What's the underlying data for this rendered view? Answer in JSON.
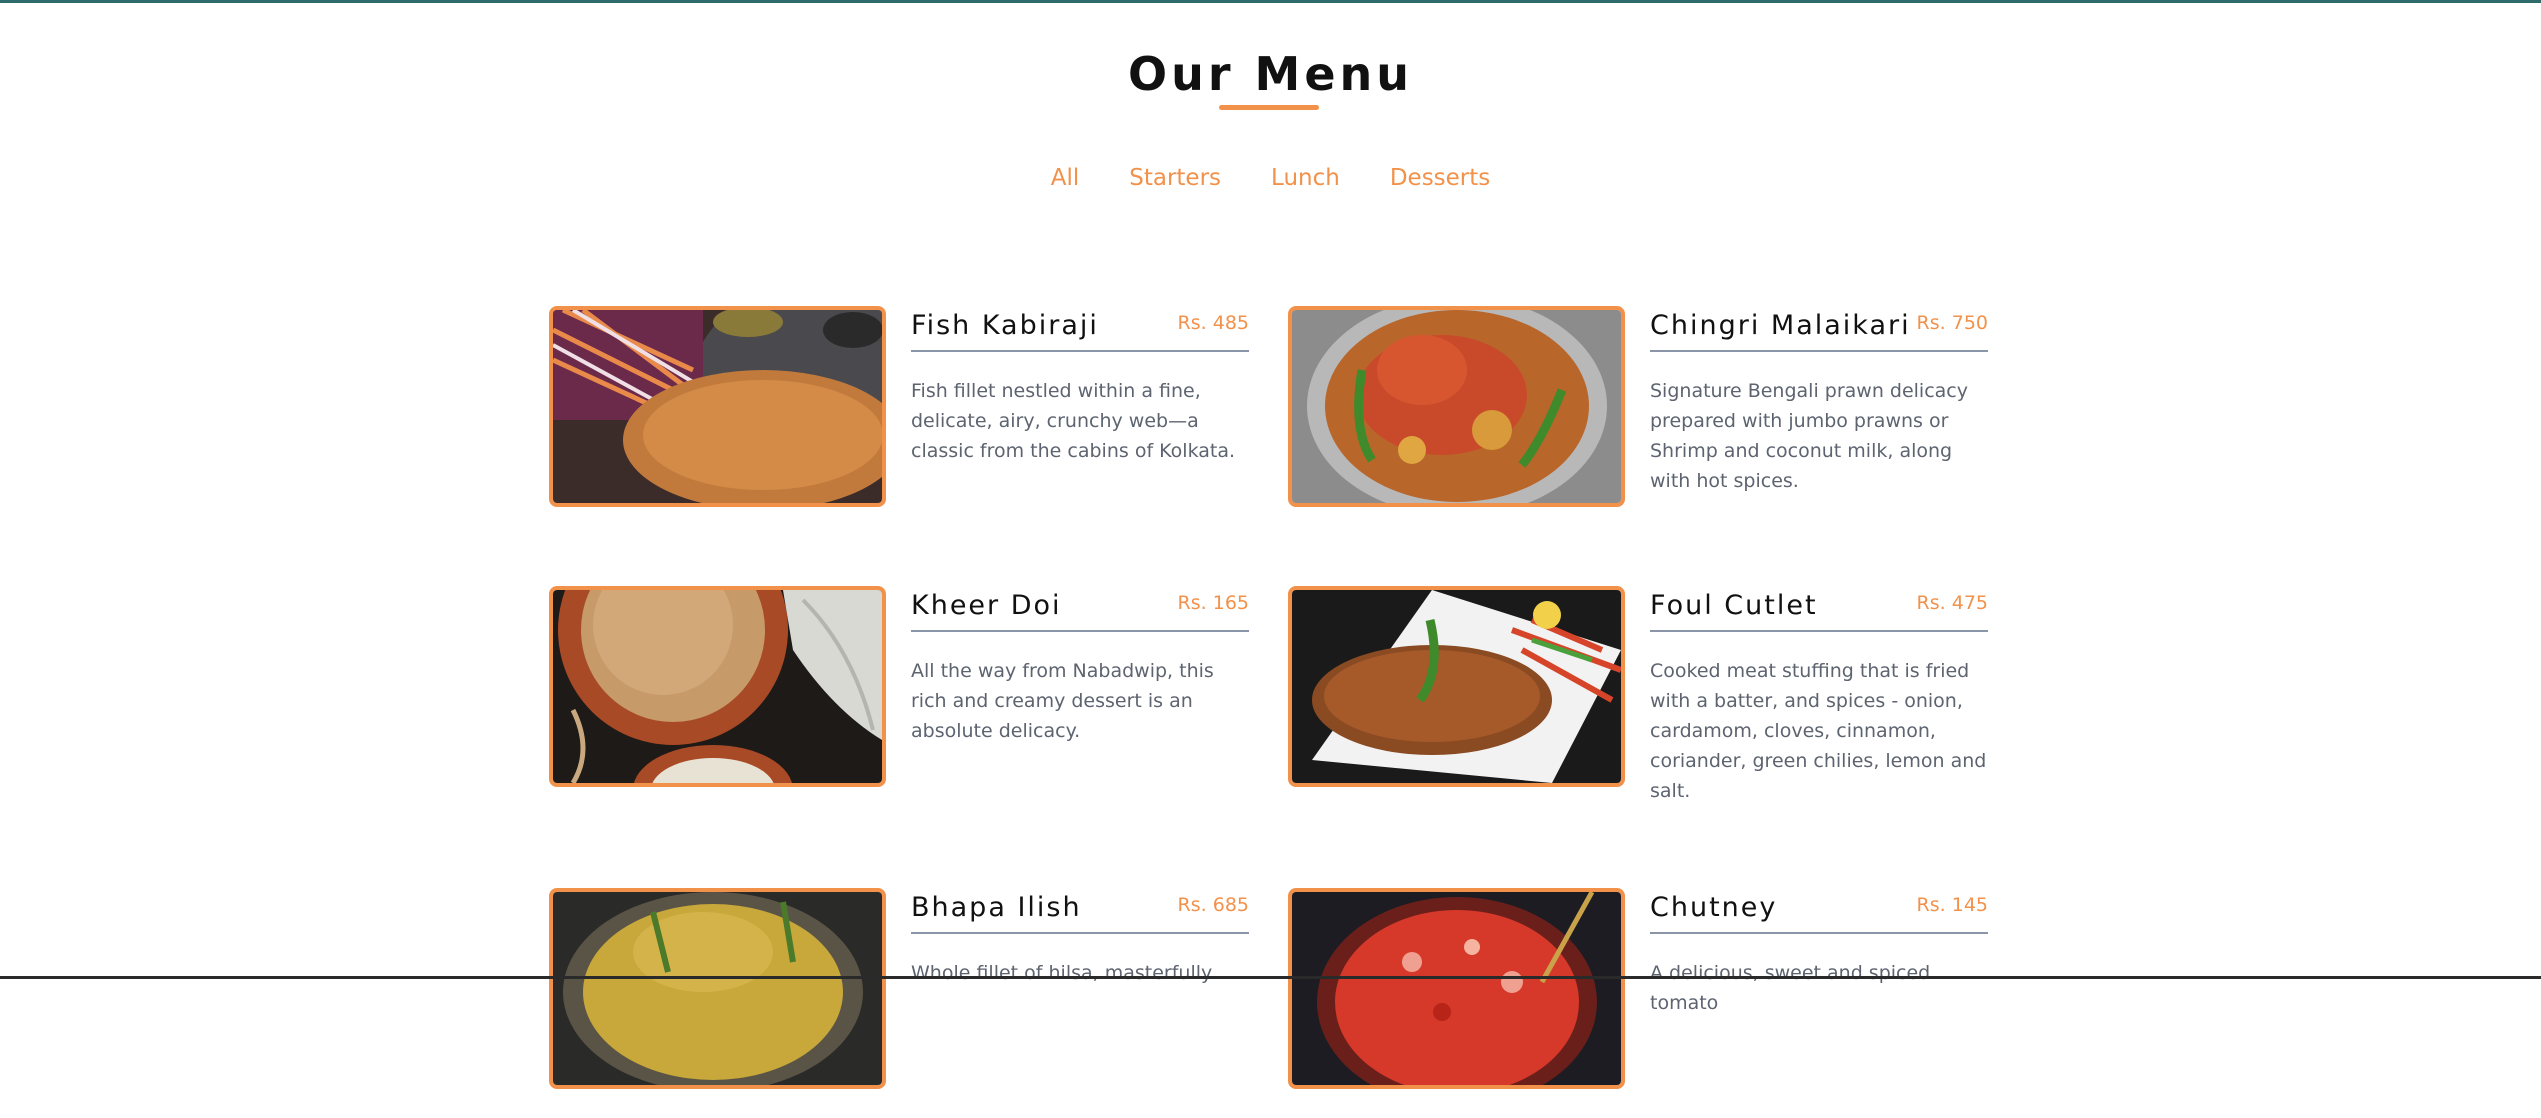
{
  "page": {
    "title": "Our Menu",
    "accent_color": "#f2914a",
    "text_color": "#111111",
    "muted_text_color": "#5d6470"
  },
  "filters": [
    {
      "label": "All"
    },
    {
      "label": "Starters"
    },
    {
      "label": "Lunch"
    },
    {
      "label": "Desserts"
    }
  ],
  "items": [
    {
      "name": "Fish Kabiraji",
      "price": "Rs. 485",
      "description": "Fish fillet nestled within a fine, delicate, airy, crunchy web—a classic from the cabins of Kolkata."
    },
    {
      "name": "Chingri Malaikari",
      "price": "Rs. 750",
      "description": "Signature Bengali prawn delicacy prepared with jumbo prawns or Shrimp and coconut milk, along with hot spices."
    },
    {
      "name": "Kheer Doi",
      "price": "Rs. 165",
      "description": "All the way from Nabadwip, this rich and creamy dessert is an absolute delicacy."
    },
    {
      "name": "Foul Cutlet",
      "price": "Rs. 475",
      "description": "Cooked meat stuffing that is fried with a batter, and spices - onion, cardamom, cloves, cinnamon, coriander, green chilies, lemon and salt."
    },
    {
      "name": "Bhapa Ilish",
      "price": "Rs. 685",
      "description": "Whole fillet of hilsa, masterfully"
    },
    {
      "name": "Chutney",
      "price": "Rs. 145",
      "description": "A delicious, sweet and spiced tomato"
    }
  ]
}
